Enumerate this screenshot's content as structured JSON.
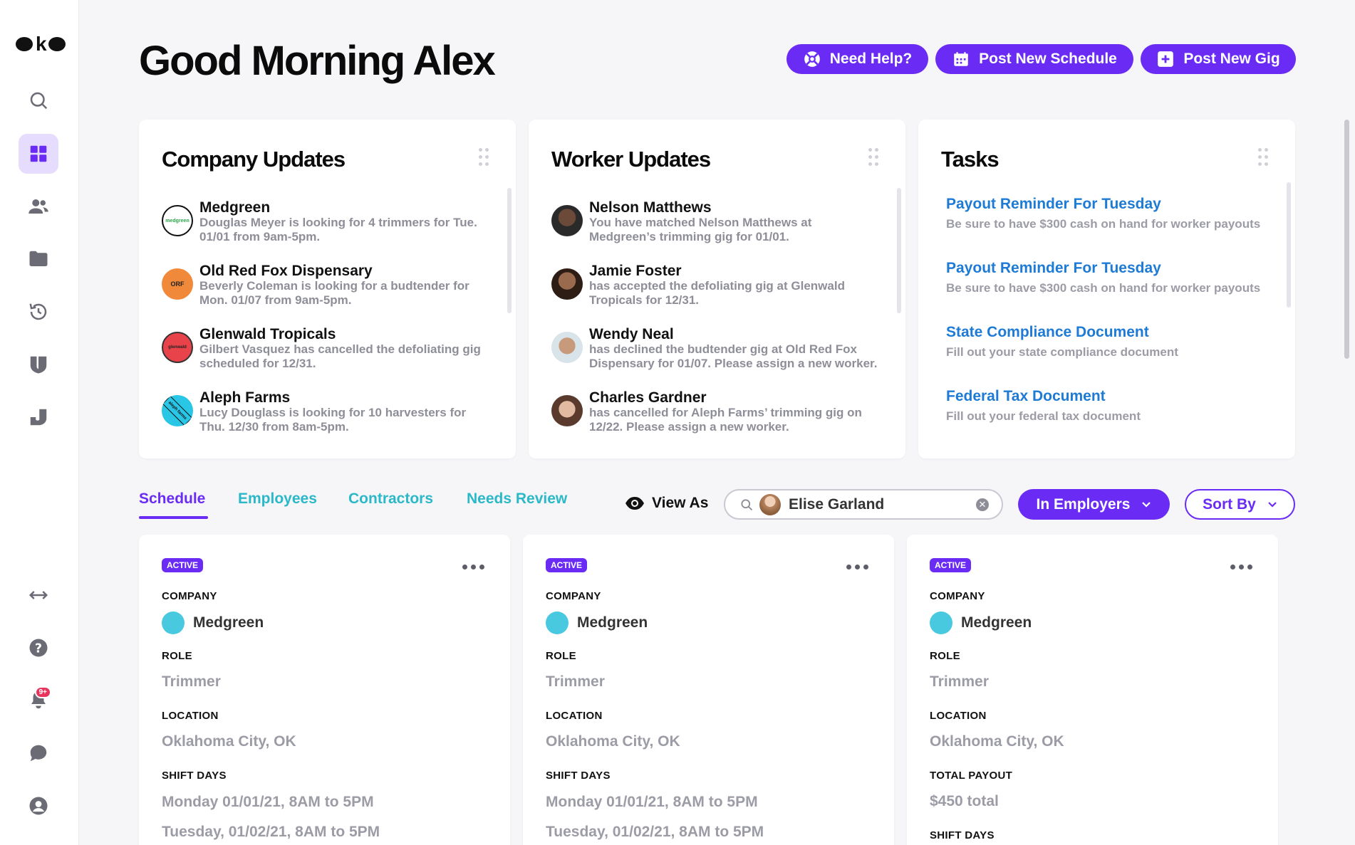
{
  "brand": {
    "logo_text": "oko"
  },
  "sidebar": {
    "items": [
      {
        "name": "search"
      },
      {
        "name": "dashboard"
      },
      {
        "name": "people"
      },
      {
        "name": "folder"
      },
      {
        "name": "history"
      },
      {
        "name": "shield"
      },
      {
        "name": "documents"
      }
    ],
    "bottom": [
      {
        "name": "swap"
      },
      {
        "name": "help"
      },
      {
        "name": "notifications",
        "badge": "9+"
      },
      {
        "name": "chat"
      },
      {
        "name": "account"
      }
    ]
  },
  "header": {
    "greeting": "Good Morning Alex",
    "buttons": {
      "help": "Need Help?",
      "post_schedule": "Post New Schedule",
      "post_gig": "Post New Gig"
    }
  },
  "company_updates": {
    "title": "Company Updates",
    "items": [
      {
        "name": "Medgreen",
        "desc": "Douglas Meyer is looking for 4 trimmers for Tue. 01/01 from 9am-5pm.",
        "logo_text": "medgreen"
      },
      {
        "name": "Old Red Fox Dispensary",
        "desc": "Beverly Coleman is looking for a budtender for Mon. 01/07 from 9am-5pm.",
        "logo_text": "ORF"
      },
      {
        "name": "Glenwald Tropicals",
        "desc": "Gilbert Vasquez has cancelled the defoliating gig scheduled for 12/31.",
        "logo_text": "glenwald"
      },
      {
        "name": "Aleph Farms",
        "desc": "Lucy Douglass is looking for 10 harvesters for Thu. 12/30 from 8am-5pm.",
        "logo_text": "aleph farms"
      }
    ]
  },
  "worker_updates": {
    "title": "Worker Updates",
    "items": [
      {
        "name": "Nelson Matthews",
        "desc": "You have matched Nelson Matthews at Medgreen’s trimming gig for 01/01."
      },
      {
        "name": "Jamie Foster",
        "desc": "has accepted the defoliating gig at Glenwald Tropicals for 12/31."
      },
      {
        "name": "Wendy Neal",
        "desc": "has declined the budtender gig at Old Red Fox Dispensary for 01/07. Please assign a new worker."
      },
      {
        "name": "Charles Gardner",
        "desc": "has cancelled for Aleph Farms’ trimming gig on 12/22. Please assign a new worker."
      }
    ]
  },
  "tasks": {
    "title": "Tasks",
    "items": [
      {
        "title": "Payout Reminder For Tuesday",
        "desc": "Be sure to have $300 cash on hand for worker payouts"
      },
      {
        "title": "Payout Reminder For Tuesday",
        "desc": "Be sure to have $300 cash on hand for worker payouts"
      },
      {
        "title": "State Compliance Document",
        "desc": "Fill out your state compliance document"
      },
      {
        "title": "Federal Tax Document",
        "desc": "Fill out your federal tax document"
      }
    ]
  },
  "tabs": {
    "items": [
      "Schedule",
      "Employees",
      "Contractors",
      "Needs Review"
    ],
    "active": "Schedule"
  },
  "filters": {
    "view_as_label": "View As",
    "search_value": "Elise Garland",
    "employer_filter": "In Employers",
    "sort_label": "Sort By"
  },
  "cards": [
    {
      "status": "ACTIVE",
      "company_label": "COMPANY",
      "company": "Medgreen",
      "role_label": "ROLE",
      "role": "Trimmer",
      "location_label": "LOCATION",
      "location": "Oklahoma City, OK",
      "fields": [
        {
          "label": "SHIFT DAYS",
          "values": [
            "Monday 01/01/21, 8AM to 5PM",
            "Tuesday, 01/02/21, 8AM to 5PM"
          ]
        }
      ]
    },
    {
      "status": "ACTIVE",
      "company_label": "COMPANY",
      "company": "Medgreen",
      "role_label": "ROLE",
      "role": "Trimmer",
      "location_label": "LOCATION",
      "location": "Oklahoma City, OK",
      "fields": [
        {
          "label": "SHIFT DAYS",
          "values": [
            "Monday 01/01/21, 8AM to 5PM",
            "Tuesday, 01/02/21, 8AM to 5PM"
          ]
        }
      ]
    },
    {
      "status": "ACTIVE",
      "company_label": "COMPANY",
      "company": "Medgreen",
      "role_label": "ROLE",
      "role": "Trimmer",
      "location_label": "LOCATION",
      "location": "Oklahoma City, OK",
      "fields": [
        {
          "label": "TOTAL PAYOUT",
          "values": [
            "$450 total"
          ]
        },
        {
          "label": "SHIFT DAYS",
          "values": []
        }
      ]
    }
  ],
  "colors": {
    "accent": "#6a2cf5",
    "teal_tab": "#2bb8c9",
    "task_link": "#1d7bd6",
    "muted_text": "#8e8e98",
    "company_dot": "#48c9e0",
    "background": "#f6f6f8"
  }
}
